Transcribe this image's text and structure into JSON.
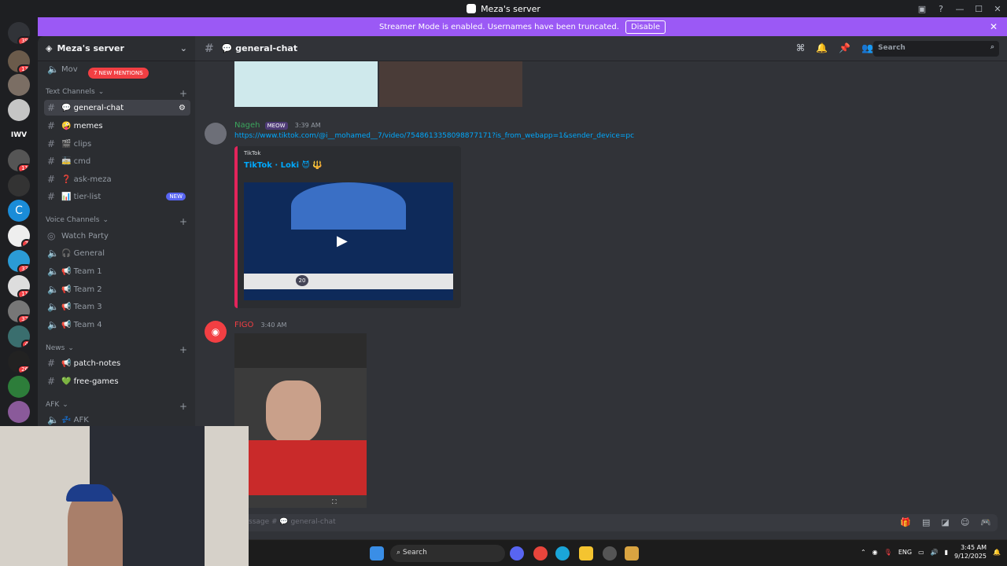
{
  "window": {
    "title": "Meza's server"
  },
  "banner": {
    "text": "Streamer Mode is enabled. Usernames have been truncated.",
    "button": "Disable",
    "color": "#9b59f5"
  },
  "rail": {
    "badges": [
      "39",
      "13",
      "11",
      "7",
      "33",
      "11",
      "32",
      "4",
      "26"
    ],
    "label_iwv": "IWV"
  },
  "sidebar": {
    "server_name": "Meza's server",
    "mentions": "7 NEW MENTIONS",
    "partial_channel": "Mov",
    "categories": {
      "text": "Text Channels",
      "voice": "Voice Channels",
      "news": "News",
      "afk": "AFK"
    },
    "text_channels": [
      {
        "name": "💬 general-chat"
      },
      {
        "name": "🤪 memes"
      },
      {
        "name": "🎬 clips"
      },
      {
        "name": "🚋 cmd"
      },
      {
        "name": "❓ ask-meza"
      },
      {
        "name": "📊 tier-list",
        "tag": "NEW"
      }
    ],
    "voice_channels": [
      "Watch Party",
      "🎧 General",
      "📢 Team 1",
      "📢 Team 2",
      "📢 Team 3",
      "📢 Team 4"
    ],
    "news_channels": [
      "📢 patch-notes",
      "💚 free-games"
    ],
    "afk_channels": [
      "💤 AFK"
    ]
  },
  "header": {
    "channel": "💬 general-chat",
    "search_placeholder": "Search"
  },
  "messages": [
    {
      "author": "Nageh",
      "tag": "MEOW",
      "time": "3:39 AM",
      "link": "https://www.tiktok.com/@i__mohamed__7/video/7548613358098877171?is_from_webapp=1&sender_device=pc",
      "embed": {
        "provider": "TikTok",
        "title": "TikTok · Loki 😈 🔱",
        "overlay_number": "20"
      }
    },
    {
      "author": "FIGO",
      "time": "3:40 AM"
    }
  ],
  "composer": {
    "placeholder": "ssage # 💬 general-chat"
  },
  "taskbar": {
    "search": "Search",
    "lang": "ENG",
    "time": "3:45 AM",
    "date": "9/12/2025"
  }
}
